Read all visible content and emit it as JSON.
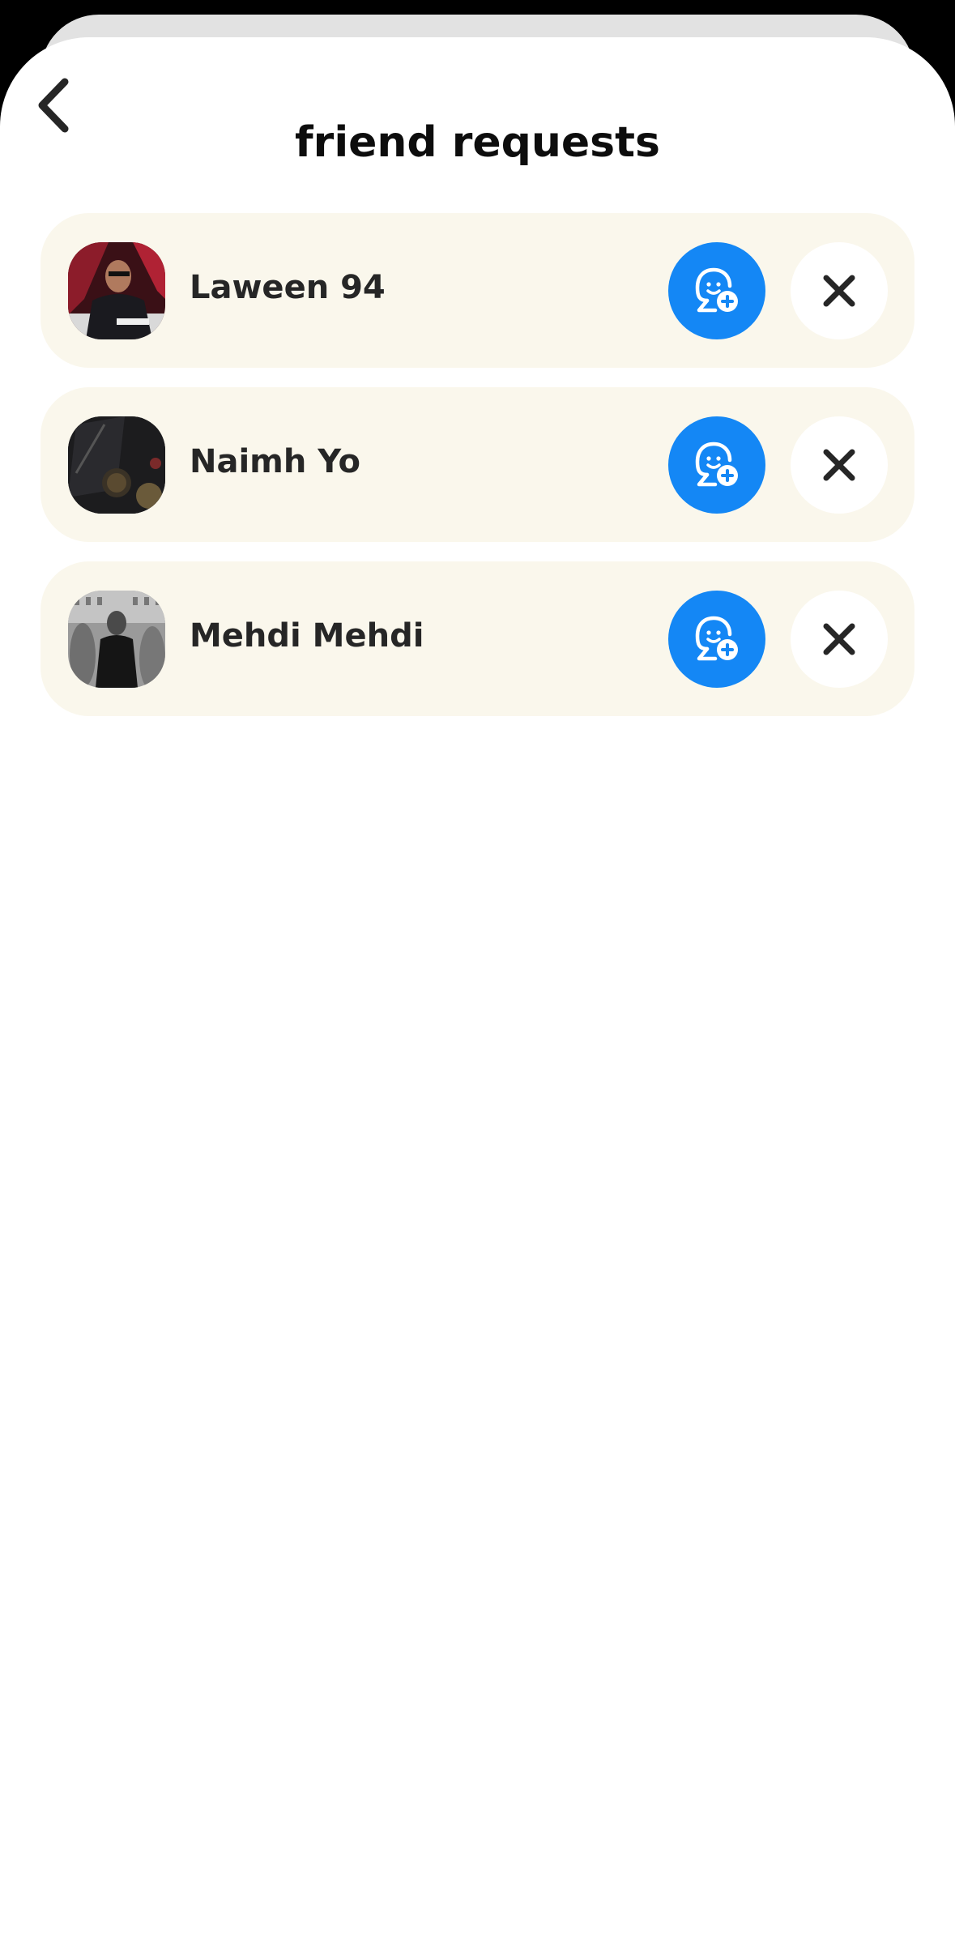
{
  "header": {
    "title": "friend requests",
    "back_icon": "chevron-left-icon"
  },
  "colors": {
    "accent": "#1487f5",
    "card_background": "#faf7ec",
    "text": "#262626"
  },
  "requests": [
    {
      "name": "Laween 94",
      "accept_icon": "add-friend-icon",
      "decline_icon": "close-icon"
    },
    {
      "name": "Naimh Yo",
      "accept_icon": "add-friend-icon",
      "decline_icon": "close-icon"
    },
    {
      "name": "Mehdi Mehdi",
      "accept_icon": "add-friend-icon",
      "decline_icon": "close-icon"
    }
  ]
}
